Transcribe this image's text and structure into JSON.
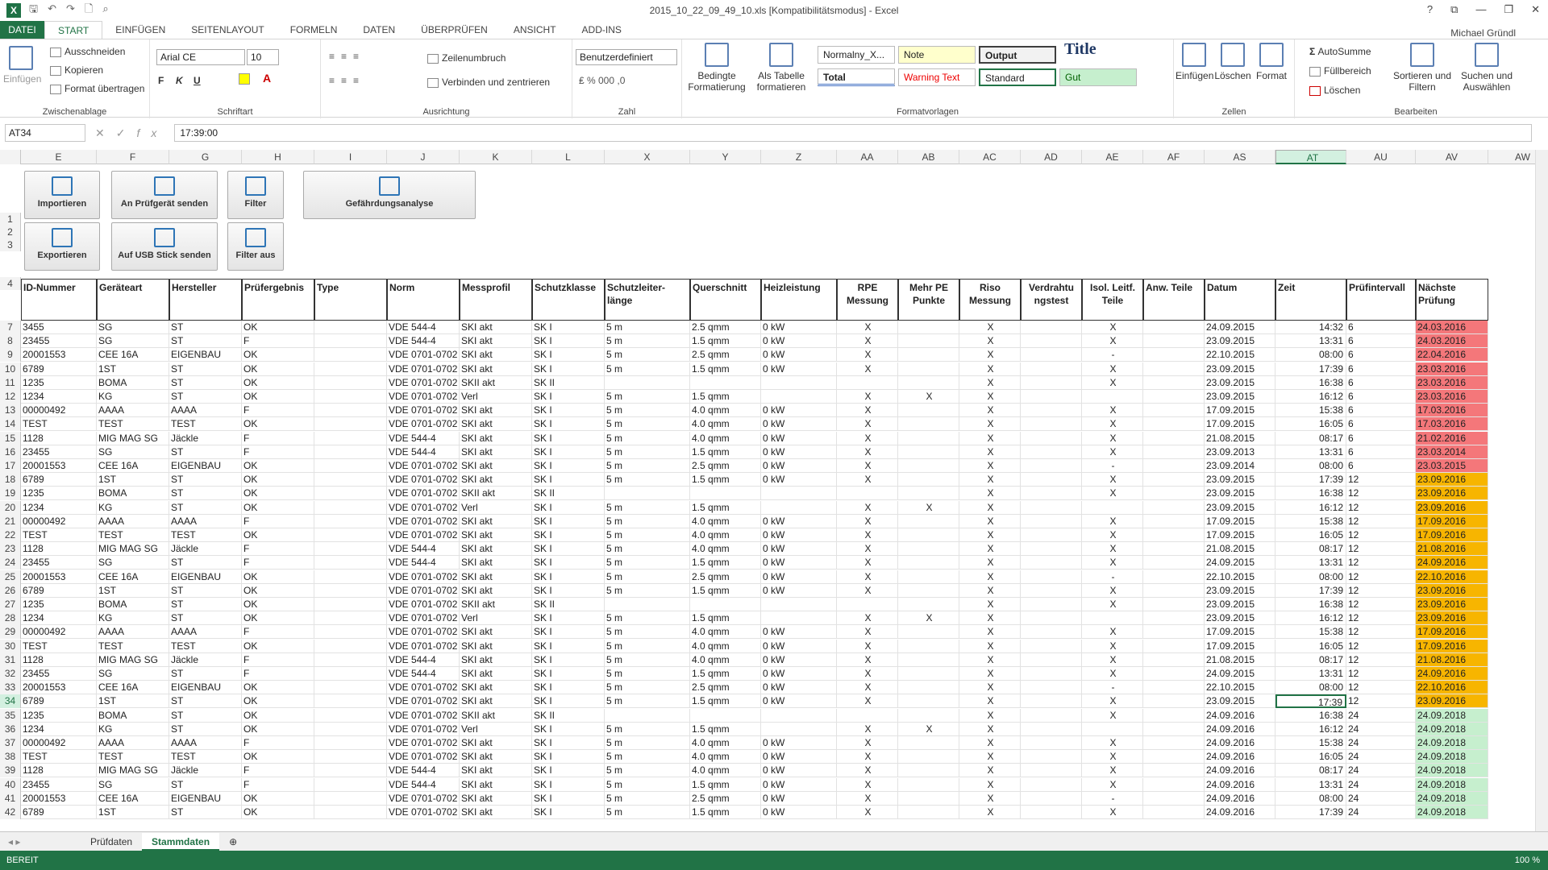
{
  "window": {
    "title": "2015_10_22_09_49_10.xls  [Kompatibilitätsmodus] - Excel",
    "user": "Michael Gründl",
    "controls": [
      "?",
      "⧉",
      "—",
      "❐",
      "✕"
    ]
  },
  "ribbon_tabs": [
    "DATEI",
    "START",
    "EINFÜGEN",
    "SEITENLAYOUT",
    "FORMELN",
    "DATEN",
    "ÜBERPRÜFEN",
    "ANSICHT",
    "ADD-INS"
  ],
  "clipboard": {
    "paste": "Einfügen",
    "cut": "Ausschneiden",
    "copy": "Kopieren",
    "painter": "Format übertragen",
    "label": "Zwischenablage"
  },
  "font": {
    "name": "Arial CE",
    "size": "10",
    "bold": "F",
    "italic": "K",
    "underline": "U",
    "label": "Schriftart"
  },
  "alignment": {
    "wrap": "Zeilenumbruch",
    "merge": "Verbinden und zentrieren",
    "label": "Ausrichtung"
  },
  "number": {
    "format": "Benutzerdefiniert",
    "label": "Zahl"
  },
  "styles": {
    "cond": "Bedingte Formatierung",
    "table": "Als Tabelle formatieren",
    "label": "Formatvorlagen",
    "cells": [
      "Normalny_X...",
      "Note",
      "Output",
      "Title",
      "Total",
      "Warning Text",
      "Standard",
      "Gut"
    ]
  },
  "cells_grp": {
    "insert": "Einfügen",
    "delete": "Löschen",
    "format": "Format",
    "label": "Zellen"
  },
  "editing": {
    "autosum": "AutoSumme",
    "fill": "Füllbereich",
    "clear": "Löschen",
    "sort": "Sortieren und Filtern",
    "find": "Suchen und Auswählen",
    "label": "Bearbeiten"
  },
  "formula_bar": {
    "namebox": "AT34",
    "fx": "fx",
    "value": "17:39:00"
  },
  "columns": [
    "E",
    "F",
    "G",
    "H",
    "I",
    "J",
    "K",
    "L",
    "X",
    "Y",
    "Z",
    "AA",
    "AB",
    "AC",
    "AD",
    "AE",
    "AF",
    "AS",
    "AT",
    "AU",
    "AV",
    "AW"
  ],
  "action_buttons": [
    "Importieren",
    "An Prüfgerät senden",
    "Filter",
    "Gefährdungsanalyse",
    "Exportieren",
    "Auf USB Stick senden",
    "Filter aus"
  ],
  "headers": [
    "ID-Nummer",
    "Geräteart",
    "Hersteller",
    "Prüfergebnis",
    "Type",
    "Norm",
    "Messprofil",
    "Schutzklasse",
    "Schutzleiter-länge",
    "Querschnitt",
    "Heizleistung",
    "RPE Messung",
    "Mehr PE Punkte",
    "Riso Messung",
    "Verdrahtu ngstest",
    "Isol. Leitf. Teile",
    "Anw. Teile",
    "Datum",
    "Zeit",
    "Prüfintervall",
    "Nächste Prüfung"
  ],
  "rows": [
    [
      "7",
      "3455",
      "SG",
      "ST",
      "OK",
      "",
      "VDE 544-4",
      "SKI akt",
      "SK I",
      "5 m",
      "2.5 qmm",
      "0 kW",
      "X",
      "",
      "X",
      "",
      "X",
      "",
      "24.09.2015",
      "14:32",
      "6",
      "24.03.2016",
      "red"
    ],
    [
      "8",
      "23455",
      "SG",
      "ST",
      "F",
      "",
      "VDE 544-4",
      "SKI akt",
      "SK I",
      "5 m",
      "1.5 qmm",
      "0 kW",
      "X",
      "",
      "X",
      "",
      "X",
      "",
      "23.09.2015",
      "13:31",
      "6",
      "24.03.2016",
      "red"
    ],
    [
      "9",
      "20001553",
      "CEE 16A",
      "EIGENBAU",
      "OK",
      "",
      "VDE 0701-0702",
      "SKI akt",
      "SK I",
      "5 m",
      "2.5 qmm",
      "0 kW",
      "X",
      "",
      "X",
      "",
      "-",
      "",
      "22.10.2015",
      "08:00",
      "6",
      "22.04.2016",
      "red"
    ],
    [
      "10",
      "6789",
      "1ST",
      "ST",
      "OK",
      "",
      "VDE 0701-0702",
      "SKI akt",
      "SK I",
      "5 m",
      "1.5 qmm",
      "0 kW",
      "X",
      "",
      "X",
      "",
      "X",
      "",
      "23.09.2015",
      "17:39",
      "6",
      "23.03.2016",
      "red"
    ],
    [
      "11",
      "1235",
      "BOMA",
      "ST",
      "OK",
      "",
      "VDE 0701-0702",
      "SKII akt",
      "SK II",
      "",
      "",
      "",
      "",
      "",
      "X",
      "",
      "X",
      "",
      "23.09.2015",
      "16:38",
      "6",
      "23.03.2016",
      "red"
    ],
    [
      "12",
      "1234",
      "KG",
      "ST",
      "OK",
      "",
      "VDE 0701-0702",
      "Verl",
      "SK I",
      "5 m",
      "1.5 qmm",
      "",
      "X",
      "X",
      "X",
      "",
      "",
      "",
      "23.09.2015",
      "16:12",
      "6",
      "23.03.2016",
      "red"
    ],
    [
      "13",
      "00000492",
      "AAAA",
      "AAAA",
      "F",
      "",
      "VDE 0701-0702",
      "SKI akt",
      "SK I",
      "5 m",
      "4.0 qmm",
      "0 kW",
      "X",
      "",
      "X",
      "",
      "X",
      "",
      "17.09.2015",
      "15:38",
      "6",
      "17.03.2016",
      "red"
    ],
    [
      "14",
      "TEST",
      "TEST",
      "TEST",
      "OK",
      "",
      "VDE 0701-0702",
      "SKI akt",
      "SK I",
      "5 m",
      "4.0 qmm",
      "0 kW",
      "X",
      "",
      "X",
      "",
      "X",
      "",
      "17.09.2015",
      "16:05",
      "6",
      "17.03.2016",
      "red"
    ],
    [
      "15",
      "1128",
      "MIG MAG SG",
      "Jäckle",
      "F",
      "",
      "VDE 544-4",
      "SKI akt",
      "SK I",
      "5 m",
      "4.0 qmm",
      "0 kW",
      "X",
      "",
      "X",
      "",
      "X",
      "",
      "21.08.2015",
      "08:17",
      "6",
      "21.02.2016",
      "red"
    ],
    [
      "16",
      "23455",
      "SG",
      "ST",
      "F",
      "",
      "VDE 544-4",
      "SKI akt",
      "SK I",
      "5 m",
      "1.5 qmm",
      "0 kW",
      "X",
      "",
      "X",
      "",
      "X",
      "",
      "23.09.2013",
      "13:31",
      "6",
      "23.03.2014",
      "red"
    ],
    [
      "17",
      "20001553",
      "CEE 16A",
      "EIGENBAU",
      "OK",
      "",
      "VDE 0701-0702",
      "SKI akt",
      "SK I",
      "5 m",
      "2.5 qmm",
      "0 kW",
      "X",
      "",
      "X",
      "",
      "-",
      "",
      "23.09.2014",
      "08:00",
      "6",
      "23.03.2015",
      "red"
    ],
    [
      "18",
      "6789",
      "1ST",
      "ST",
      "OK",
      "",
      "VDE 0701-0702",
      "SKI akt",
      "SK I",
      "5 m",
      "1.5 qmm",
      "0 kW",
      "X",
      "",
      "X",
      "",
      "X",
      "",
      "23.09.2015",
      "17:39",
      "12",
      "23.09.2016",
      "orange"
    ],
    [
      "19",
      "1235",
      "BOMA",
      "ST",
      "OK",
      "",
      "VDE 0701-0702",
      "SKII akt",
      "SK II",
      "",
      "",
      "",
      "",
      "",
      "X",
      "",
      "X",
      "",
      "23.09.2015",
      "16:38",
      "12",
      "23.09.2016",
      "orange"
    ],
    [
      "20",
      "1234",
      "KG",
      "ST",
      "OK",
      "",
      "VDE 0701-0702",
      "Verl",
      "SK I",
      "5 m",
      "1.5 qmm",
      "",
      "X",
      "X",
      "X",
      "",
      "",
      "",
      "23.09.2015",
      "16:12",
      "12",
      "23.09.2016",
      "orange"
    ],
    [
      "21",
      "00000492",
      "AAAA",
      "AAAA",
      "F",
      "",
      "VDE 0701-0702",
      "SKI akt",
      "SK I",
      "5 m",
      "4.0 qmm",
      "0 kW",
      "X",
      "",
      "X",
      "",
      "X",
      "",
      "17.09.2015",
      "15:38",
      "12",
      "17.09.2016",
      "orange"
    ],
    [
      "22",
      "TEST",
      "TEST",
      "TEST",
      "OK",
      "",
      "VDE 0701-0702",
      "SKI akt",
      "SK I",
      "5 m",
      "4.0 qmm",
      "0 kW",
      "X",
      "",
      "X",
      "",
      "X",
      "",
      "17.09.2015",
      "16:05",
      "12",
      "17.09.2016",
      "orange"
    ],
    [
      "23",
      "1128",
      "MIG MAG SG",
      "Jäckle",
      "F",
      "",
      "VDE 544-4",
      "SKI akt",
      "SK I",
      "5 m",
      "4.0 qmm",
      "0 kW",
      "X",
      "",
      "X",
      "",
      "X",
      "",
      "21.08.2015",
      "08:17",
      "12",
      "21.08.2016",
      "orange"
    ],
    [
      "24",
      "23455",
      "SG",
      "ST",
      "F",
      "",
      "VDE 544-4",
      "SKI akt",
      "SK I",
      "5 m",
      "1.5 qmm",
      "0 kW",
      "X",
      "",
      "X",
      "",
      "X",
      "",
      "24.09.2015",
      "13:31",
      "12",
      "24.09.2016",
      "orange"
    ],
    [
      "25",
      "20001553",
      "CEE 16A",
      "EIGENBAU",
      "OK",
      "",
      "VDE 0701-0702",
      "SKI akt",
      "SK I",
      "5 m",
      "2.5 qmm",
      "0 kW",
      "X",
      "",
      "X",
      "",
      "-",
      "",
      "22.10.2015",
      "08:00",
      "12",
      "22.10.2016",
      "orange"
    ],
    [
      "26",
      "6789",
      "1ST",
      "ST",
      "OK",
      "",
      "VDE 0701-0702",
      "SKI akt",
      "SK I",
      "5 m",
      "1.5 qmm",
      "0 kW",
      "X",
      "",
      "X",
      "",
      "X",
      "",
      "23.09.2015",
      "17:39",
      "12",
      "23.09.2016",
      "orange"
    ],
    [
      "27",
      "1235",
      "BOMA",
      "ST",
      "OK",
      "",
      "VDE 0701-0702",
      "SKII akt",
      "SK II",
      "",
      "",
      "",
      "",
      "",
      "X",
      "",
      "X",
      "",
      "23.09.2015",
      "16:38",
      "12",
      "23.09.2016",
      "orange"
    ],
    [
      "28",
      "1234",
      "KG",
      "ST",
      "OK",
      "",
      "VDE 0701-0702",
      "Verl",
      "SK I",
      "5 m",
      "1.5 qmm",
      "",
      "X",
      "X",
      "X",
      "",
      "",
      "",
      "23.09.2015",
      "16:12",
      "12",
      "23.09.2016",
      "orange"
    ],
    [
      "29",
      "00000492",
      "AAAA",
      "AAAA",
      "F",
      "",
      "VDE 0701-0702",
      "SKI akt",
      "SK I",
      "5 m",
      "4.0 qmm",
      "0 kW",
      "X",
      "",
      "X",
      "",
      "X",
      "",
      "17.09.2015",
      "15:38",
      "12",
      "17.09.2016",
      "orange"
    ],
    [
      "30",
      "TEST",
      "TEST",
      "TEST",
      "OK",
      "",
      "VDE 0701-0702",
      "SKI akt",
      "SK I",
      "5 m",
      "4.0 qmm",
      "0 kW",
      "X",
      "",
      "X",
      "",
      "X",
      "",
      "17.09.2015",
      "16:05",
      "12",
      "17.09.2016",
      "orange"
    ],
    [
      "31",
      "1128",
      "MIG MAG SG",
      "Jäckle",
      "F",
      "",
      "VDE 544-4",
      "SKI akt",
      "SK I",
      "5 m",
      "4.0 qmm",
      "0 kW",
      "X",
      "",
      "X",
      "",
      "X",
      "",
      "21.08.2015",
      "08:17",
      "12",
      "21.08.2016",
      "orange"
    ],
    [
      "32",
      "23455",
      "SG",
      "ST",
      "F",
      "",
      "VDE 544-4",
      "SKI akt",
      "SK I",
      "5 m",
      "1.5 qmm",
      "0 kW",
      "X",
      "",
      "X",
      "",
      "X",
      "",
      "24.09.2015",
      "13:31",
      "12",
      "24.09.2016",
      "orange"
    ],
    [
      "33",
      "20001553",
      "CEE 16A",
      "EIGENBAU",
      "OK",
      "",
      "VDE 0701-0702",
      "SKI akt",
      "SK I",
      "5 m",
      "2.5 qmm",
      "0 kW",
      "X",
      "",
      "X",
      "",
      "-",
      "",
      "22.10.2015",
      "08:00",
      "12",
      "22.10.2016",
      "orange"
    ],
    [
      "34",
      "6789",
      "1ST",
      "ST",
      "OK",
      "",
      "VDE 0701-0702",
      "SKI akt",
      "SK I",
      "5 m",
      "1.5 qmm",
      "0 kW",
      "X",
      "",
      "X",
      "",
      "X",
      "",
      "23.09.2015",
      "17:39",
      "12",
      "23.09.2016",
      "orange"
    ],
    [
      "35",
      "1235",
      "BOMA",
      "ST",
      "OK",
      "",
      "VDE 0701-0702",
      "SKII akt",
      "SK II",
      "",
      "",
      "",
      "",
      "",
      "X",
      "",
      "X",
      "",
      "24.09.2016",
      "16:38",
      "24",
      "24.09.2018",
      "green"
    ],
    [
      "36",
      "1234",
      "KG",
      "ST",
      "OK",
      "",
      "VDE 0701-0702",
      "Verl",
      "SK I",
      "5 m",
      "1.5 qmm",
      "",
      "X",
      "X",
      "X",
      "",
      "",
      "",
      "24.09.2016",
      "16:12",
      "24",
      "24.09.2018",
      "green"
    ],
    [
      "37",
      "00000492",
      "AAAA",
      "AAAA",
      "F",
      "",
      "VDE 0701-0702",
      "SKI akt",
      "SK I",
      "5 m",
      "4.0 qmm",
      "0 kW",
      "X",
      "",
      "X",
      "",
      "X",
      "",
      "24.09.2016",
      "15:38",
      "24",
      "24.09.2018",
      "green"
    ],
    [
      "38",
      "TEST",
      "TEST",
      "TEST",
      "OK",
      "",
      "VDE 0701-0702",
      "SKI akt",
      "SK I",
      "5 m",
      "4.0 qmm",
      "0 kW",
      "X",
      "",
      "X",
      "",
      "X",
      "",
      "24.09.2016",
      "16:05",
      "24",
      "24.09.2018",
      "green"
    ],
    [
      "39",
      "1128",
      "MIG MAG SG",
      "Jäckle",
      "F",
      "",
      "VDE 544-4",
      "SKI akt",
      "SK I",
      "5 m",
      "4.0 qmm",
      "0 kW",
      "X",
      "",
      "X",
      "",
      "X",
      "",
      "24.09.2016",
      "08:17",
      "24",
      "24.09.2018",
      "green"
    ],
    [
      "40",
      "23455",
      "SG",
      "ST",
      "F",
      "",
      "VDE 544-4",
      "SKI akt",
      "SK I",
      "5 m",
      "1.5 qmm",
      "0 kW",
      "X",
      "",
      "X",
      "",
      "X",
      "",
      "24.09.2016",
      "13:31",
      "24",
      "24.09.2018",
      "green"
    ],
    [
      "41",
      "20001553",
      "CEE 16A",
      "EIGENBAU",
      "OK",
      "",
      "VDE 0701-0702",
      "SKI akt",
      "SK I",
      "5 m",
      "2.5 qmm",
      "0 kW",
      "X",
      "",
      "X",
      "",
      "-",
      "",
      "24.09.2016",
      "08:00",
      "24",
      "24.09.2018",
      "green"
    ],
    [
      "42",
      "6789",
      "1ST",
      "ST",
      "OK",
      "",
      "VDE 0701-0702",
      "SKI akt",
      "SK I",
      "5 m",
      "1.5 qmm",
      "0 kW",
      "X",
      "",
      "X",
      "",
      "X",
      "",
      "24.09.2016",
      "17:39",
      "24",
      "24.09.2018",
      "green"
    ]
  ],
  "colors": {
    "red": "#f4777a",
    "orange": "#f7b500",
    "green": "#c6efce",
    "accent": "#217346"
  },
  "sheets": [
    "Prüfdaten",
    "Stammdaten"
  ],
  "status": {
    "ready": "BEREIT",
    "zoom": "100 %"
  }
}
